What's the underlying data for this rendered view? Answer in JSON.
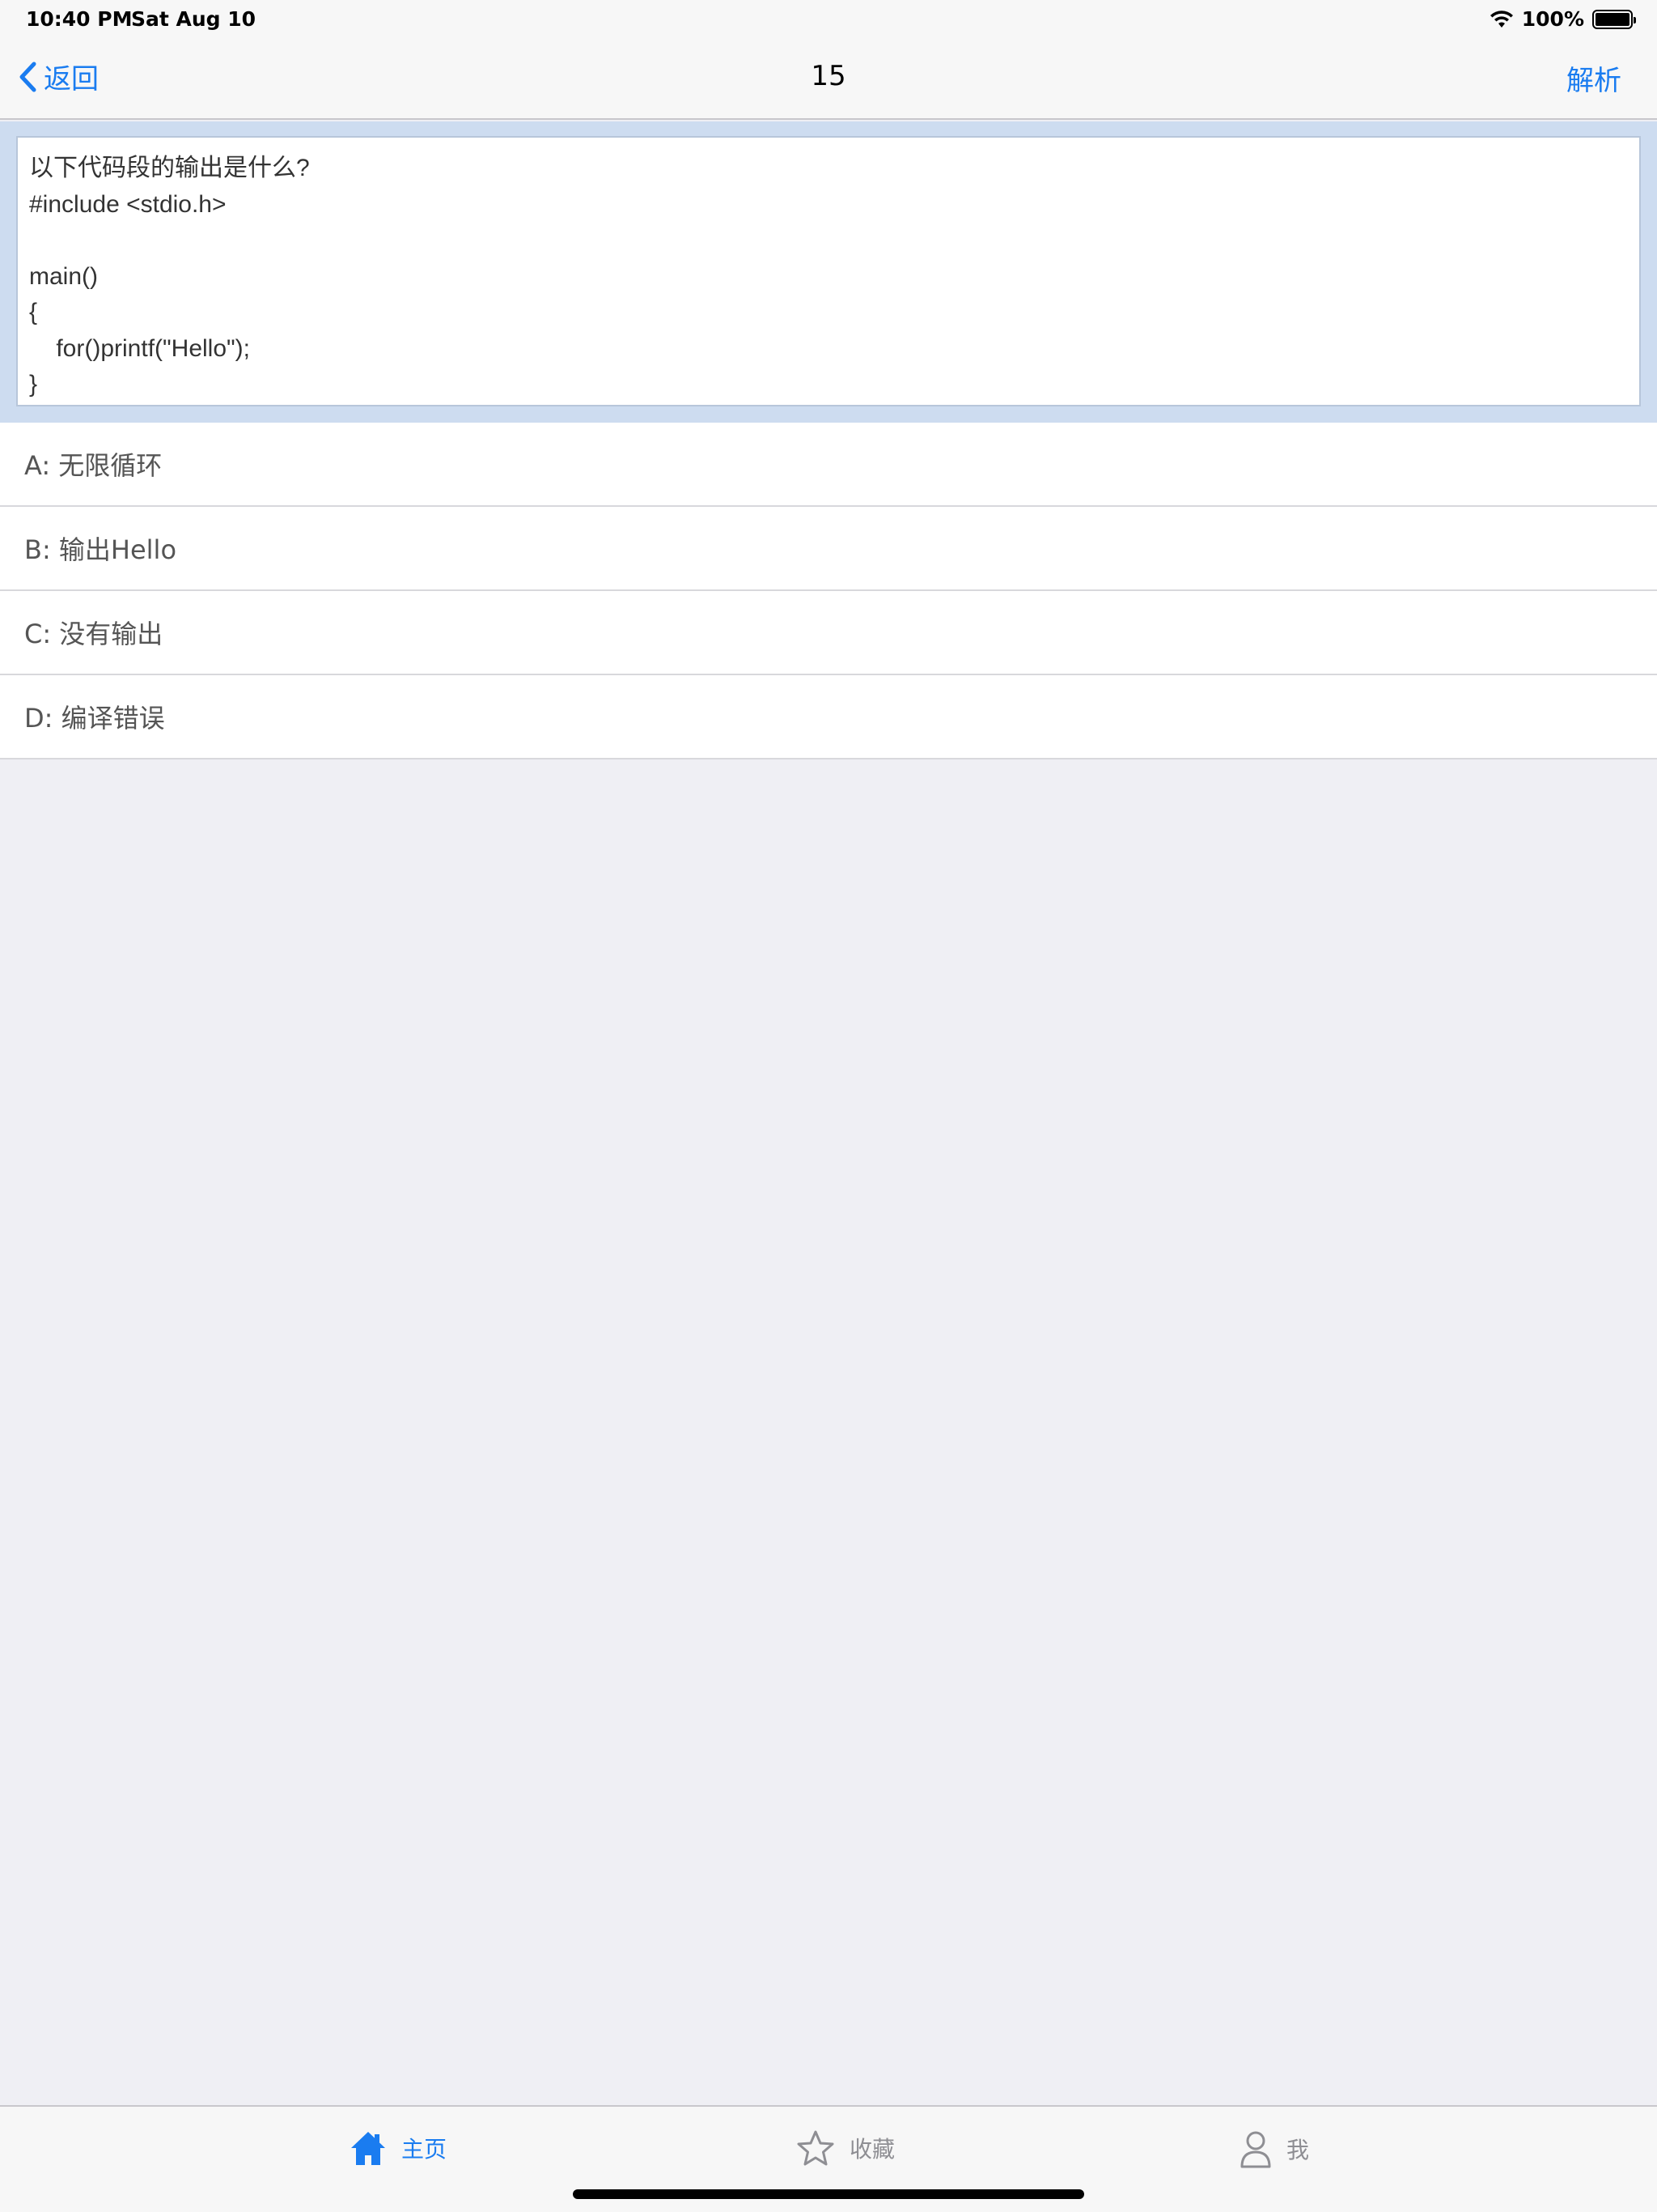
{
  "status_bar": {
    "time": "10:40 PM",
    "date": "Sat Aug 10",
    "battery": "100%",
    "icons": [
      "wifi-icon",
      "battery-icon"
    ]
  },
  "nav": {
    "back_label": "返回",
    "title": "15",
    "right_label": "解析"
  },
  "question": {
    "text": "以下代码段的输出是什么?\n#include <stdio.h>\n\nmain()\n{\n    for()printf(\"Hello\");\n}"
  },
  "options": [
    {
      "label": "A:  无限循环"
    },
    {
      "label": "B:  输出Hello"
    },
    {
      "label": "C:  没有输出"
    },
    {
      "label": "D:  编译错误"
    }
  ],
  "tabs": [
    {
      "label": "主页",
      "icon": "home-icon",
      "active": true
    },
    {
      "label": "收藏",
      "icon": "star-icon",
      "active": false
    },
    {
      "label": "我",
      "icon": "person-icon",
      "active": false
    }
  ],
  "colors": {
    "accent": "#1a7cf0",
    "inactive": "#8e8e93",
    "background": "#efeff4",
    "question_panel": "#cddcf0"
  }
}
